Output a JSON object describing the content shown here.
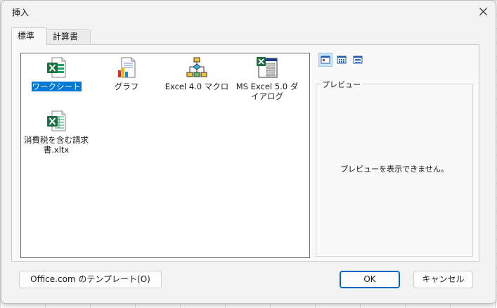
{
  "dialog": {
    "title": "挿入",
    "close_icon": "close-icon"
  },
  "tabs": [
    {
      "label": "標準",
      "active": true
    },
    {
      "label": "計算書",
      "active": false
    }
  ],
  "templates": [
    {
      "label": "ワークシート",
      "icon": "excel-worksheet-icon",
      "selected": true
    },
    {
      "label": "グラフ",
      "icon": "chart-sheet-icon",
      "selected": false
    },
    {
      "label": "Excel 4.0 マクロ",
      "icon": "macro-flowchart-icon",
      "selected": false
    },
    {
      "label": "MS Excel 5.0 ダイアログ",
      "icon": "dialog-sheet-icon",
      "selected": false
    },
    {
      "label": "消費税を含む請求書.xltx",
      "icon": "excel-template-icon",
      "selected": false
    }
  ],
  "view_buttons": [
    {
      "icon": "large-icons-view-icon",
      "active": true
    },
    {
      "icon": "list-view-icon",
      "active": false
    },
    {
      "icon": "details-view-icon",
      "active": false
    }
  ],
  "preview": {
    "label": "プレビュー",
    "message": "プレビューを表示できません。"
  },
  "buttons": {
    "office_templates": "Office.com のテンプレート(O)",
    "ok": "OK",
    "cancel": "キャンセル"
  },
  "colors": {
    "selection": "#0078d7",
    "excel_green": "#1d6f42"
  }
}
